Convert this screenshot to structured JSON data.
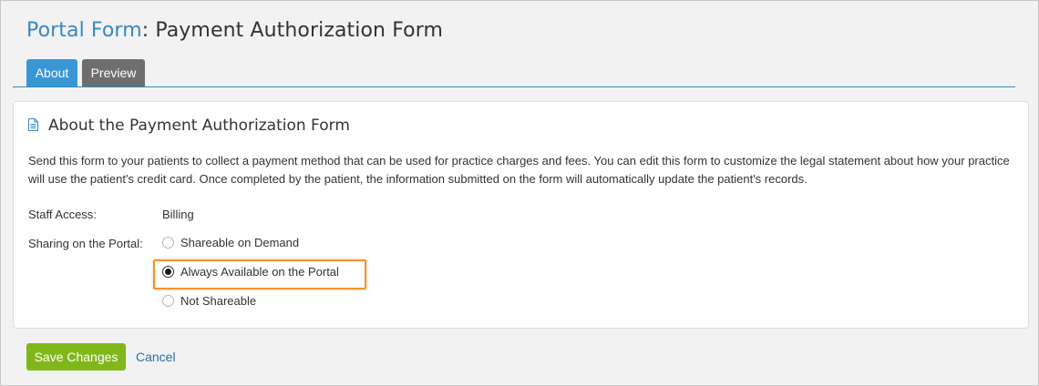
{
  "header": {
    "title_prefix": "Portal Form",
    "title_separator": ": ",
    "title_name": "Payment Authorization Form"
  },
  "tabs": [
    {
      "label": "About",
      "active": true
    },
    {
      "label": "Preview",
      "active": false
    }
  ],
  "panel": {
    "icon": "document-icon",
    "heading": "About the Payment Authorization Form",
    "description": "Send this form to your patients to collect a payment method that can be used for practice charges and fees. You can edit this form to customize the legal statement about how your practice will use the patient's credit card. Once completed by the patient, the information submitted on the form will automatically update the patient's records.",
    "staff_access": {
      "label": "Staff Access:",
      "value": "Billing"
    },
    "sharing": {
      "label": "Sharing on the Portal:",
      "options": [
        {
          "label": "Shareable on Demand",
          "selected": false
        },
        {
          "label": "Always Available on the Portal",
          "selected": true
        },
        {
          "label": "Not Shareable",
          "selected": false
        }
      ]
    }
  },
  "actions": {
    "save_label": "Save Changes",
    "cancel_label": "Cancel"
  },
  "colors": {
    "accent": "#3a87c0",
    "save_green": "#80b81c",
    "highlight_orange": "#f0932e",
    "tab_inactive": "#6e6e6e"
  }
}
